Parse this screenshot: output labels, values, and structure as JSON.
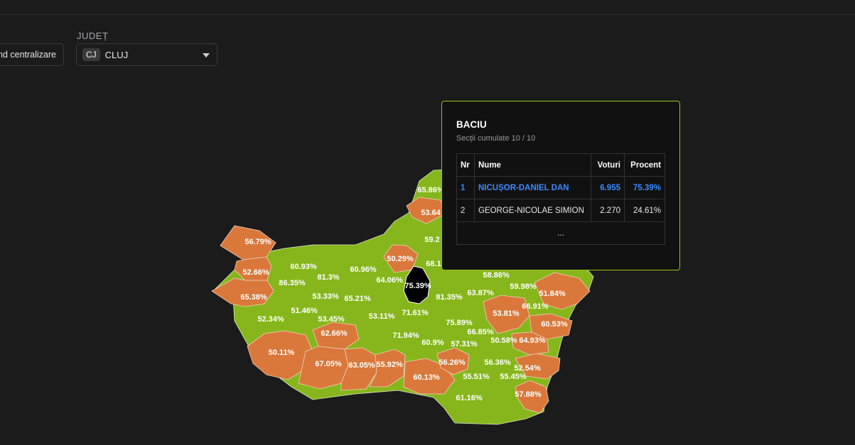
{
  "toolbar": {
    "mode_button_label": "nd centralizare",
    "judet_label": "JUDEȚ",
    "judet_code": "CJ",
    "judet_name": "CLUJ"
  },
  "colors": {
    "background": "#1b1b1b",
    "winner_dan": "#86b61b",
    "winner_simion": "#d9783a",
    "selected": "#000000",
    "tooltip_border": "#9ac31a",
    "highlight_text": "#3b8bff"
  },
  "map": {
    "percent_labels": [
      "65.86%",
      "53.64",
      "59.2",
      "50.29%",
      "68.1",
      "56.79%",
      "60.93%",
      "52.66%",
      "81.3%",
      "60.96%",
      "86.35%",
      "64.06%",
      "75.39%",
      "58.86%",
      "65.38%",
      "53.33%",
      "65.21%",
      "81.35%",
      "63.87%",
      "59.98%",
      "51.84%",
      "51.46%",
      "53.81%",
      "66.91%",
      "52.34%",
      "53.45%",
      "53.11%",
      "71.61%",
      "75.89%",
      "66.85%",
      "60.53%",
      "62.66%",
      "71.94%",
      "57.31%",
      "50.58%",
      "64.93%",
      "60.9%",
      "50.11%",
      "67.05%",
      "63.05%",
      "55.92%",
      "56.26%",
      "56.36%",
      "52.54%",
      "60.13%",
      "55.51%",
      "55.45%",
      "61.16%",
      "57.88%"
    ]
  },
  "tooltip": {
    "title": "BACIU",
    "subtitle": "Secții cumulate 10 / 10",
    "headers": {
      "nr": "Nr",
      "name": "Nume",
      "votes": "Voturi",
      "percent": "Procent"
    },
    "rows": [
      {
        "nr": "1",
        "name": "NICUȘOR-DANIEL DAN",
        "votes": "6.955",
        "percent": "75.39%"
      },
      {
        "nr": "2",
        "name": "GEORGE-NICOLAE SIMION",
        "votes": "2.270",
        "percent": "24.61%"
      }
    ],
    "more": "..."
  }
}
